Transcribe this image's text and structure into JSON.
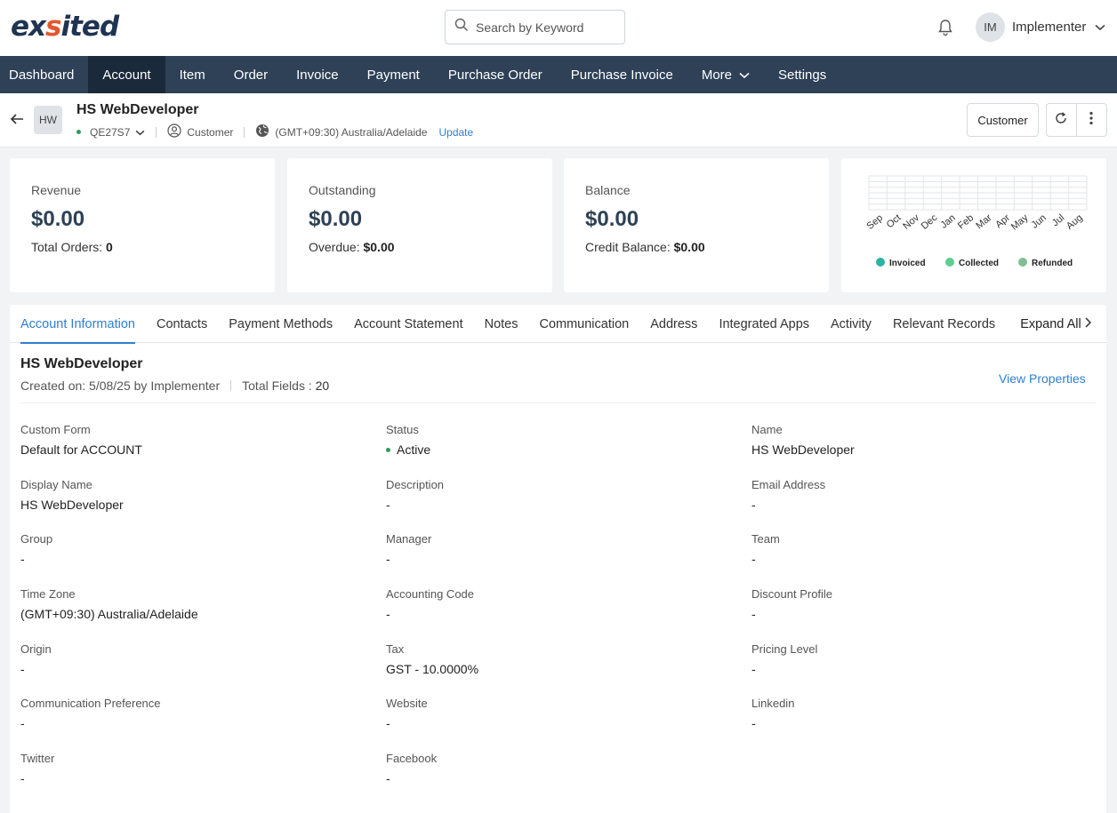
{
  "app": {
    "logo_prefix": "ex",
    "logo_mid": "s",
    "logo_suffix": "ited"
  },
  "header": {
    "search_placeholder": "Search by Keyword",
    "user_initials": "IM",
    "user_name": "Implementer"
  },
  "nav": {
    "items": [
      "Dashboard",
      "Account",
      "Item",
      "Order",
      "Invoice",
      "Payment",
      "Purchase Order",
      "Purchase Invoice",
      "More",
      "Settings"
    ],
    "active": "Account"
  },
  "account": {
    "badge": "HW",
    "name": "HS WebDeveloper",
    "code": "QE27S7",
    "type": "Customer",
    "timezone": "(GMT+09:30) Australia/Adelaide",
    "update_label": "Update",
    "type_button": "Customer"
  },
  "kpis": {
    "revenue": {
      "label": "Revenue",
      "value": "$0.00",
      "sub_label": "Total Orders:",
      "sub_value": "0"
    },
    "outstanding": {
      "label": "Outstanding",
      "value": "$0.00",
      "sub_label": "Overdue:",
      "sub_value": "$0.00"
    },
    "balance": {
      "label": "Balance",
      "value": "$0.00",
      "sub_label": "Credit Balance:",
      "sub_value": "$0.00"
    }
  },
  "chart_data": {
    "type": "bar",
    "categories": [
      "Sep",
      "Oct",
      "Nov",
      "Dec",
      "Jan",
      "Feb",
      "Mar",
      "Apr",
      "May",
      "Jun",
      "Jul",
      "Aug"
    ],
    "series": [
      {
        "name": "Invoiced",
        "color": "#2bb3a3",
        "values": [
          0,
          0,
          0,
          0,
          0,
          0,
          0,
          0,
          0,
          0,
          0,
          0
        ]
      },
      {
        "name": "Collected",
        "color": "#5ccf8f",
        "values": [
          0,
          0,
          0,
          0,
          0,
          0,
          0,
          0,
          0,
          0,
          0,
          0
        ]
      },
      {
        "name": "Refunded",
        "color": "#7fbf95",
        "values": [
          0,
          0,
          0,
          0,
          0,
          0,
          0,
          0,
          0,
          0,
          0,
          0
        ]
      }
    ],
    "grid": true,
    "legend": "bottom"
  },
  "tabs": {
    "items": [
      "Account Information",
      "Contacts",
      "Payment Methods",
      "Account Statement",
      "Notes",
      "Communication",
      "Address",
      "Integrated Apps",
      "Activity",
      "Relevant Records"
    ],
    "active": "Account Information",
    "expand_label": "Expand All"
  },
  "info": {
    "title": "HS WebDeveloper",
    "created": "Created on: 5/08/25 by Implementer",
    "total_fields_label": "Total Fields :",
    "total_fields_value": "20",
    "view_properties": "View Properties"
  },
  "fields": [
    {
      "label": "Custom Form",
      "value": "Default for ACCOUNT"
    },
    {
      "label": "Status",
      "value": "Active",
      "status": true
    },
    {
      "label": "Name",
      "value": "HS WebDeveloper"
    },
    {
      "label": "Display Name",
      "value": "HS WebDeveloper"
    },
    {
      "label": "Description",
      "value": "-"
    },
    {
      "label": "Email Address",
      "value": "-"
    },
    {
      "label": "Group",
      "value": "-"
    },
    {
      "label": "Manager",
      "value": "-"
    },
    {
      "label": "Team",
      "value": "-"
    },
    {
      "label": "Time Zone",
      "value": "(GMT+09:30) Australia/Adelaide"
    },
    {
      "label": "Accounting Code",
      "value": "-"
    },
    {
      "label": "Discount Profile",
      "value": "-"
    },
    {
      "label": "Origin",
      "value": "-"
    },
    {
      "label": "Tax",
      "value": "GST - 10.0000%"
    },
    {
      "label": "Pricing Level",
      "value": "-"
    },
    {
      "label": "Communication Preference",
      "value": "-"
    },
    {
      "label": "Website",
      "value": "-"
    },
    {
      "label": "Linkedin",
      "value": "-"
    },
    {
      "label": "Twitter",
      "value": "-"
    },
    {
      "label": "Facebook",
      "value": "-"
    }
  ]
}
